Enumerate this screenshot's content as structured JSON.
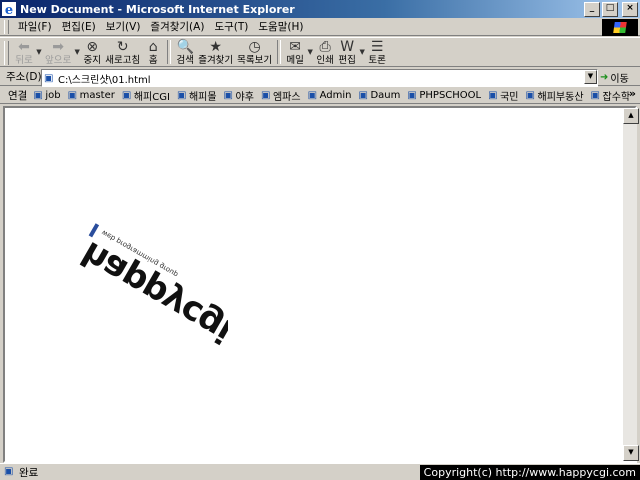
{
  "window": {
    "title": "New Document - Microsoft Internet Explorer",
    "controls": [
      "_",
      "□",
      "×"
    ]
  },
  "menu": [
    "파일(F)",
    "편집(E)",
    "보기(V)",
    "즐겨찾기(A)",
    "도구(T)",
    "도움말(H)"
  ],
  "toolbar": [
    {
      "label": "뒤로",
      "icon": "back-arrow-icon",
      "glyph": "⬅",
      "disabled": true,
      "dropdown": true
    },
    {
      "label": "앞으로",
      "icon": "forward-arrow-icon",
      "glyph": "➡",
      "disabled": true,
      "dropdown": true
    },
    {
      "label": "중지",
      "icon": "stop-icon",
      "glyph": "⊗",
      "disabled": false
    },
    {
      "label": "새로고침",
      "icon": "refresh-icon",
      "glyph": "↻",
      "disabled": false
    },
    {
      "label": "홈",
      "icon": "home-icon",
      "glyph": "⌂",
      "disabled": false
    },
    {
      "label": "검색",
      "icon": "search-icon",
      "glyph": "🔍",
      "disabled": false
    },
    {
      "label": "즐겨찾기",
      "icon": "favorites-icon",
      "glyph": "★",
      "disabled": false
    },
    {
      "label": "목록보기",
      "icon": "history-icon",
      "glyph": "◷",
      "disabled": false
    },
    {
      "label": "메일",
      "icon": "mail-icon",
      "glyph": "✉",
      "disabled": false,
      "dropdown": true
    },
    {
      "label": "인쇄",
      "icon": "print-icon",
      "glyph": "⎙",
      "disabled": false
    },
    {
      "label": "편집",
      "icon": "edit-icon",
      "glyph": "W",
      "disabled": false,
      "dropdown": true
    },
    {
      "label": "토론",
      "icon": "discuss-icon",
      "glyph": "☰",
      "disabled": false
    }
  ],
  "address": {
    "label": "주소(D)",
    "value": "C:\\스크린샷\\01.html",
    "go_label": "이동"
  },
  "links": {
    "label": "연결",
    "items": [
      "job",
      "master",
      "해피CGI",
      "해피몰",
      "야후",
      "엠파스",
      "Admin",
      "Daum",
      "PHPSCHOOL",
      "국민",
      "해피부동산",
      "잡수학"
    ],
    "more": "»"
  },
  "logo": {
    "wordmark": "happycgi",
    "tagline": "web programming group"
  },
  "status": {
    "text": "완료"
  },
  "overlay": {
    "copyright": "Copyright(c) http://www.happycgi.com"
  },
  "colors": {
    "chrome": "#d4d0c8",
    "title_start": "#0a246a",
    "title_end": "#a6caf0",
    "logo_accent": "#2a4d9c"
  }
}
